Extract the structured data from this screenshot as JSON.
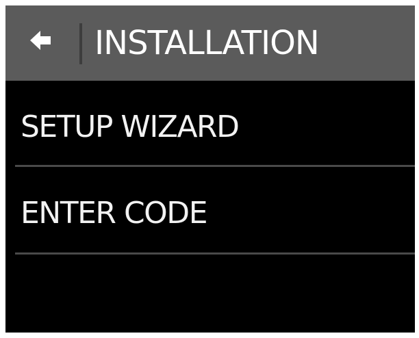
{
  "header": {
    "title": "INSTALLATION",
    "back_icon": "back-arrow-icon"
  },
  "menu": {
    "items": [
      {
        "label": "SETUP WIZARD"
      },
      {
        "label": "ENTER CODE"
      }
    ]
  },
  "colors": {
    "header_background": "#5b5b5b",
    "screen_background": "#000000",
    "text": "#ffffff",
    "separator": "#4a4a4a"
  }
}
